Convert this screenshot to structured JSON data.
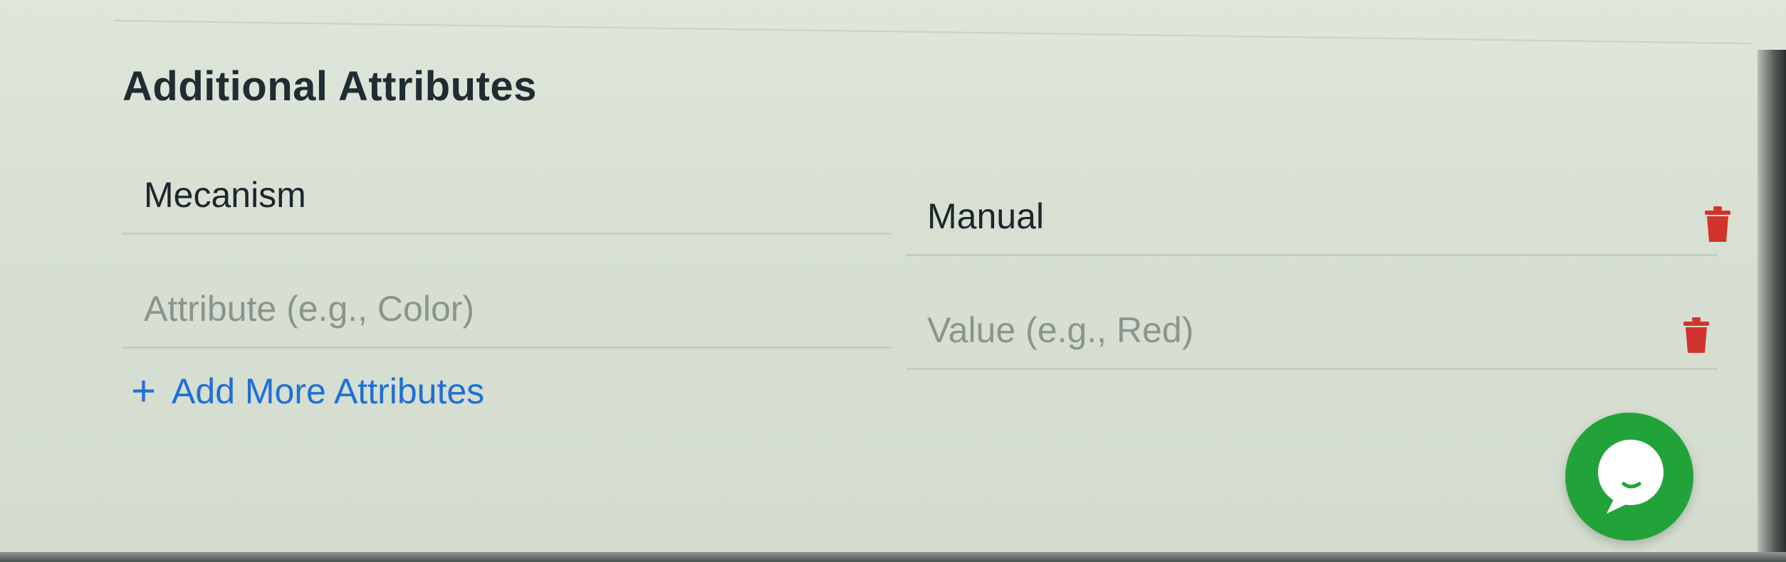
{
  "section": {
    "title": "Additional Attributes"
  },
  "attributes": [
    {
      "key_value": "Mecanism",
      "key_placeholder": "",
      "value_value": "Manual",
      "value_placeholder": ""
    },
    {
      "key_value": "",
      "key_placeholder": "Attribute (e.g., Color)",
      "value_value": "",
      "value_placeholder": "Value (e.g., Red)"
    }
  ],
  "actions": {
    "add_more_label": "Add More Attributes"
  },
  "icons": {
    "delete": "trash-icon",
    "add": "plus-icon",
    "chat": "chat-icon",
    "resize": "resize-grip-icon"
  },
  "colors": {
    "accent_link": "#1f6fd6",
    "danger": "#d0342c",
    "chat_fab": "#22a33a",
    "title_text": "#1f2d33"
  }
}
